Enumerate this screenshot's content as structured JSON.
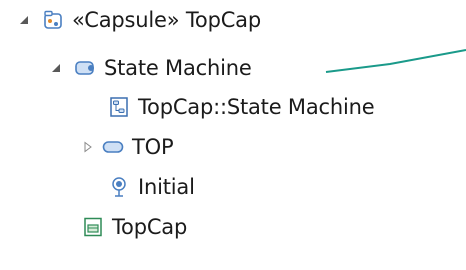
{
  "tree": {
    "items": [
      {
        "label": "«Capsule» TopCap",
        "icon": "capsule-icon",
        "expanded": true
      },
      {
        "label": "State Machine",
        "icon": "state-machine-icon",
        "expanded": true
      },
      {
        "label": "TopCap::State Machine",
        "icon": "diagram-icon"
      },
      {
        "label": "TOP",
        "icon": "state-icon",
        "expanded": false
      },
      {
        "label": "Initial",
        "icon": "initial-pseudostate-icon"
      },
      {
        "label": "TopCap",
        "icon": "class-diagram-icon"
      }
    ]
  },
  "colors": {
    "callout_line": "#1a9a8a",
    "icon_blue": "#4a7fc1",
    "icon_fill_blue": "#cfe0f5",
    "icon_green": "#2e8b57"
  }
}
